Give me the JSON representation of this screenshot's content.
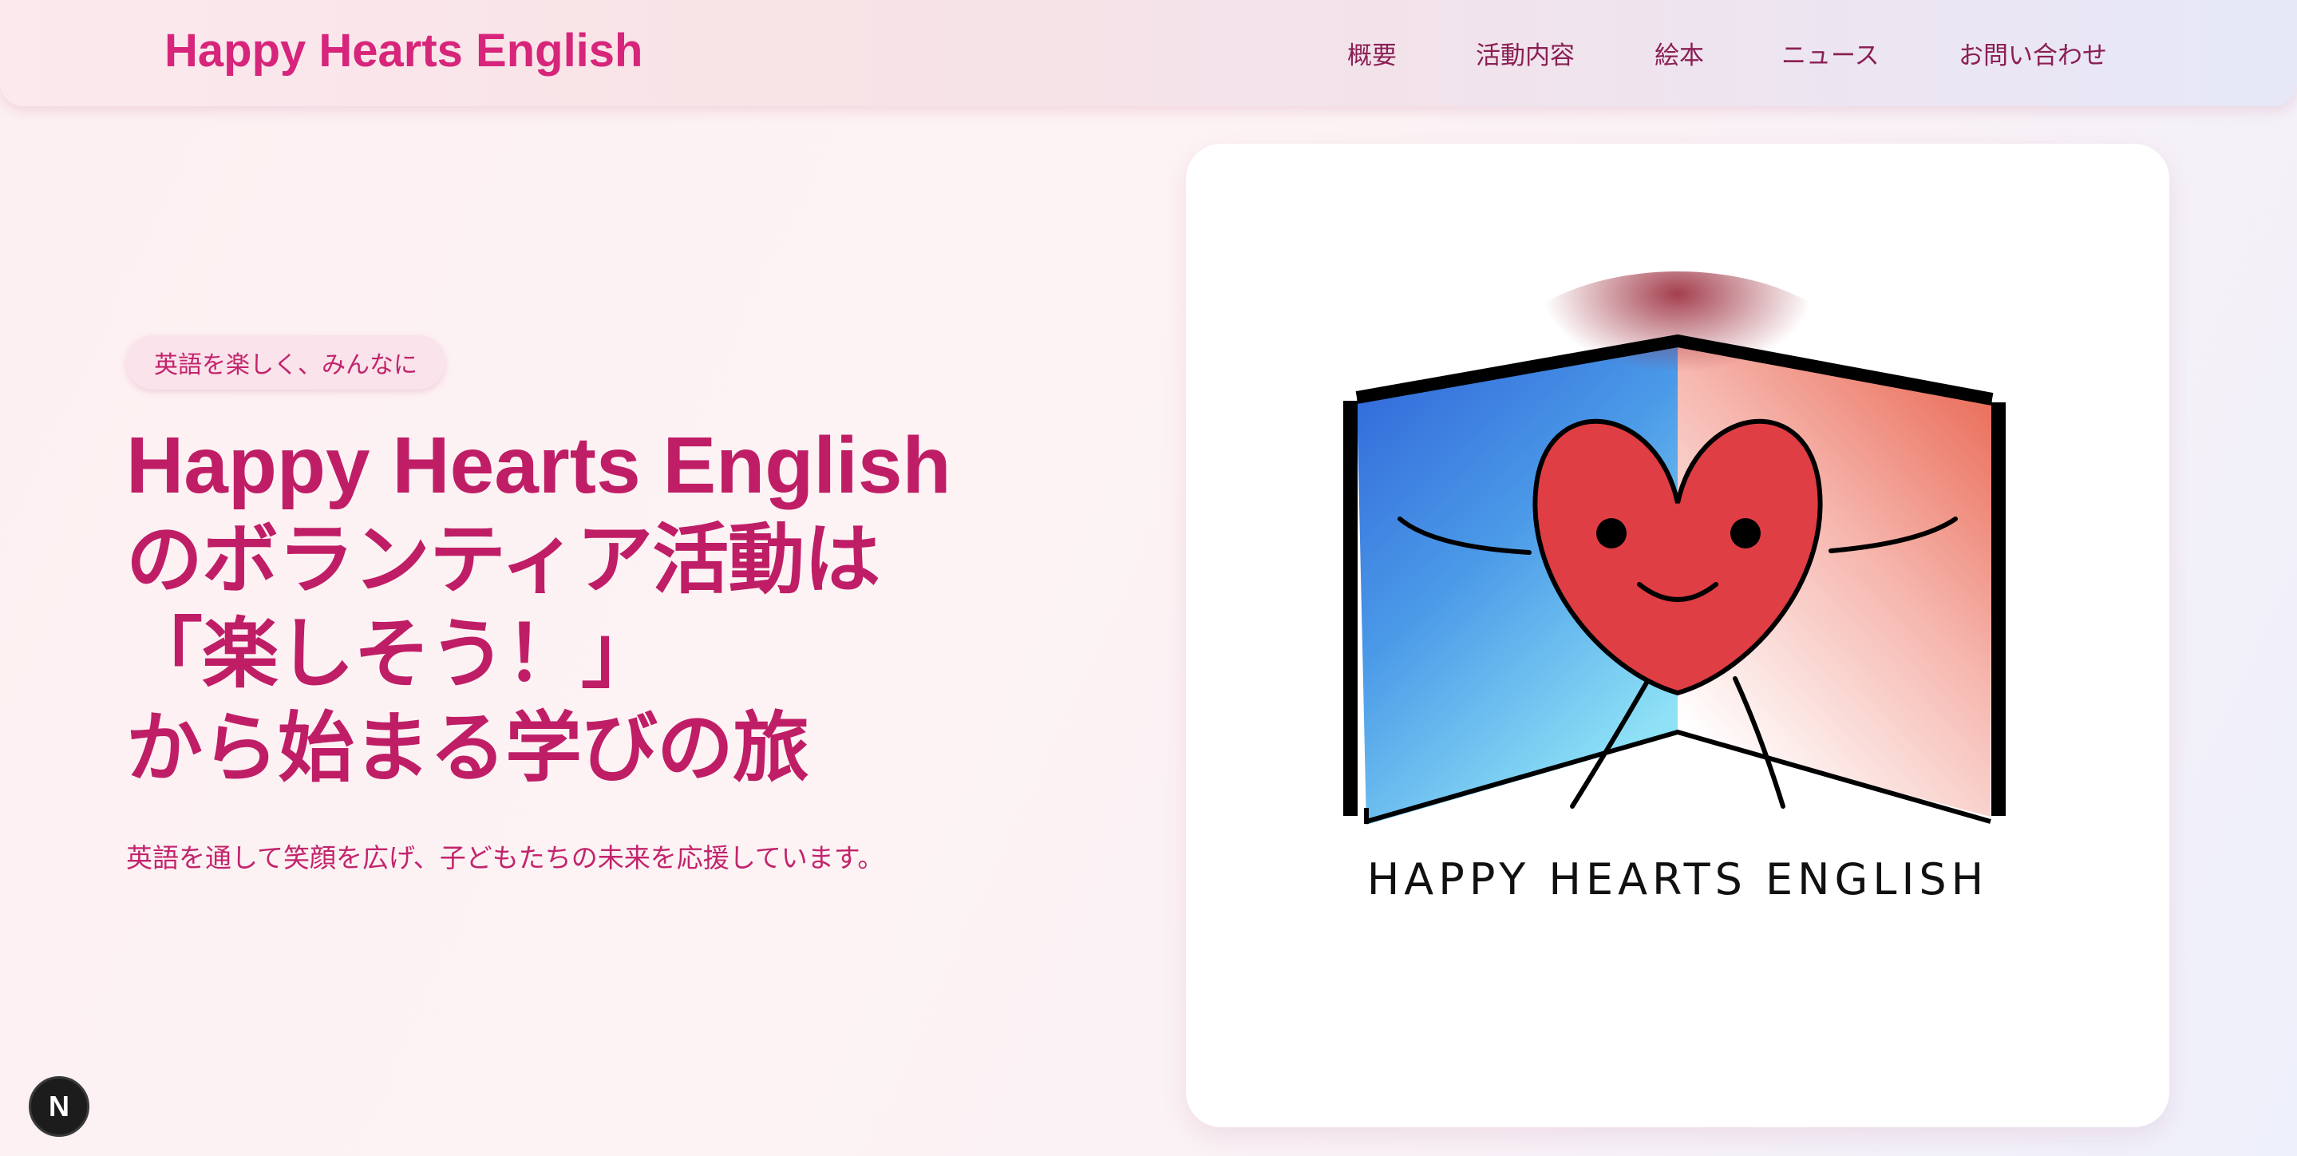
{
  "header": {
    "brand": "Happy Hearts English",
    "nav": [
      "概要",
      "活動内容",
      "絵本",
      "ニュース",
      "お問い合わせ"
    ]
  },
  "hero": {
    "pill": "英語を楽しく、みんなに",
    "headline": {
      "line1": "Happy Hearts English",
      "line2": "のボランティア活動は",
      "line3": "「楽しそう！」",
      "line4": "から始まる学びの旅"
    },
    "subtext": "英語を通して笑顔を広げ、子どもたちの未来を応援しています。"
  },
  "logo": {
    "text": "HAPPY HEARTS ENGLISH",
    "icon": "book-heart-character-logo"
  },
  "dev_badge": {
    "label": "N",
    "icon": "nextjs-dev-indicator-icon"
  },
  "colors": {
    "brand_pink": "#d6257a",
    "headline": "#bf1e66",
    "nav_text": "#8a1f54",
    "heart": "#df3e44"
  }
}
